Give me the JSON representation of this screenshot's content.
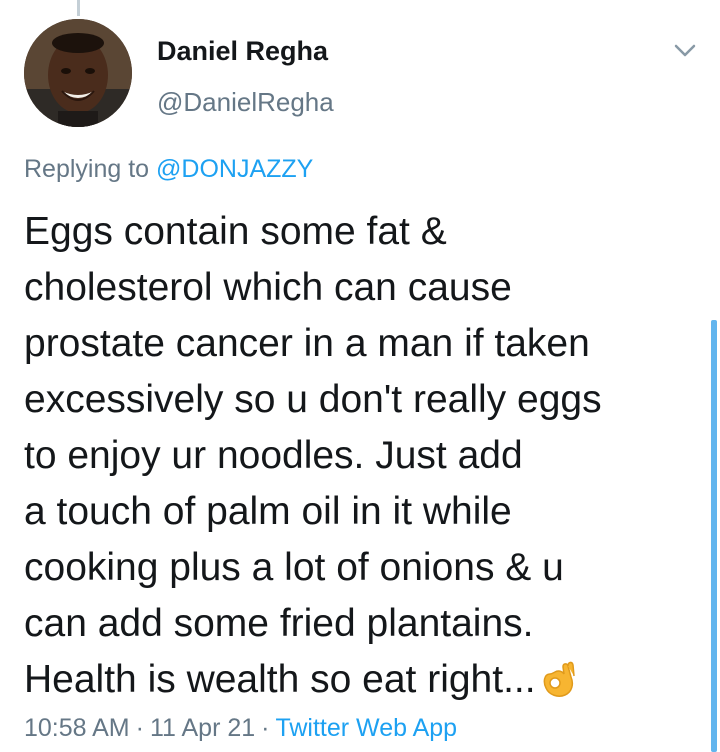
{
  "author": {
    "display_name": "Daniel Regha",
    "handle": "@DanielRegha",
    "avatar_icon": "profile-photo"
  },
  "reply": {
    "prefix": "Replying to",
    "mention": "@DONJAZZY"
  },
  "tweet": {
    "lines": [
      "Eggs contain some fat &",
      "cholesterol which can cause",
      "prostate cancer in a man if taken",
      "excessively so u don't really eggs",
      "to enjoy ur noodles. Just add",
      "a touch of palm oil in it while",
      "cooking plus a lot of onions & u",
      "can add some fried plantains.",
      "Health is wealth so eat right..."
    ],
    "emoji_icon": "ok-hand-emoji"
  },
  "meta": {
    "time": "10:58 AM",
    "date": "11 Apr 21",
    "source": "Twitter Web App",
    "separator": "·"
  },
  "colors": {
    "text_primary": "#14171a",
    "text_secondary": "#657786",
    "link": "#1da1f2",
    "emoji": "#f7b531"
  }
}
